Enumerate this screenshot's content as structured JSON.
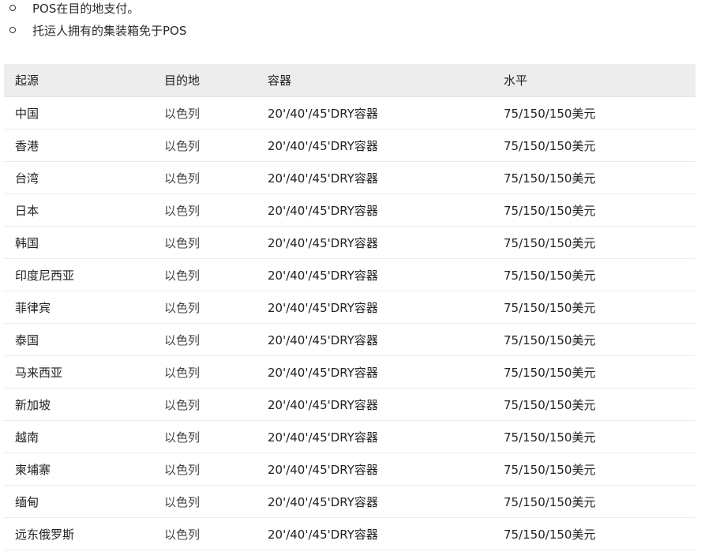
{
  "bullets": [
    "POS在目的地支付。",
    "托运人拥有的集装箱免于POS"
  ],
  "table": {
    "headers": [
      "起源",
      "目的地",
      "容器",
      "水平"
    ],
    "rows": [
      [
        "中国",
        "以色列",
        "20'/40'/45'DRY容器",
        "75/150/150美元"
      ],
      [
        "香港",
        "以色列",
        "20'/40'/45'DRY容器",
        "75/150/150美元"
      ],
      [
        "台湾",
        "以色列",
        "20'/40'/45'DRY容器",
        "75/150/150美元"
      ],
      [
        "日本",
        "以色列",
        "20'/40'/45'DRY容器",
        "75/150/150美元"
      ],
      [
        "韩国",
        "以色列",
        "20'/40'/45'DRY容器",
        "75/150/150美元"
      ],
      [
        "印度尼西亚",
        "以色列",
        "20'/40'/45'DRY容器",
        "75/150/150美元"
      ],
      [
        "菲律宾",
        "以色列",
        "20'/40'/45'DRY容器",
        "75/150/150美元"
      ],
      [
        "泰国",
        "以色列",
        "20'/40'/45'DRY容器",
        "75/150/150美元"
      ],
      [
        "马来西亚",
        "以色列",
        "20'/40'/45'DRY容器",
        "75/150/150美元"
      ],
      [
        "新加坡",
        "以色列",
        "20'/40'/45'DRY容器",
        "75/150/150美元"
      ],
      [
        "越南",
        "以色列",
        "20'/40'/45'DRY容器",
        "75/150/150美元"
      ],
      [
        "柬埔寨",
        "以色列",
        "20'/40'/45'DRY容器",
        "75/150/150美元"
      ],
      [
        "缅甸",
        "以色列",
        "20'/40'/45'DRY容器",
        "75/150/150美元"
      ],
      [
        "远东俄罗斯",
        "以色列",
        "20'/40'/45'DRY容器",
        "75/150/150美元"
      ]
    ]
  }
}
